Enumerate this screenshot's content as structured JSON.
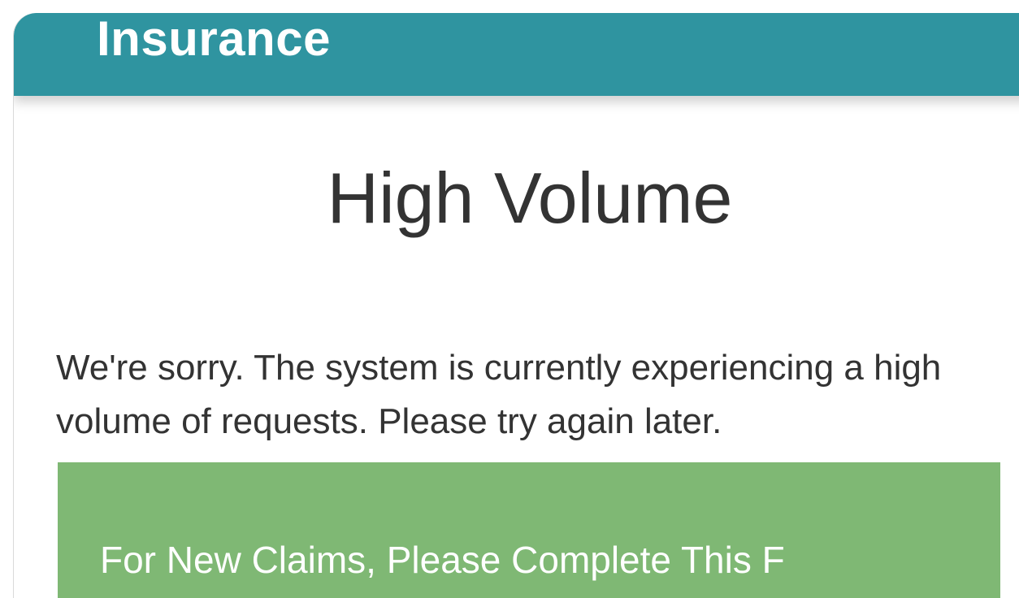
{
  "header": {
    "title": "Insurance"
  },
  "main": {
    "title": "High Volume",
    "message": "We're sorry. The system is currently experiencing a high volume of requests. Please try again later.",
    "claim_button_label": "For New Claims, Please Complete This F"
  },
  "colors": {
    "header_bg": "#2f94a0",
    "button_bg": "#7fb874",
    "text": "#333333"
  }
}
